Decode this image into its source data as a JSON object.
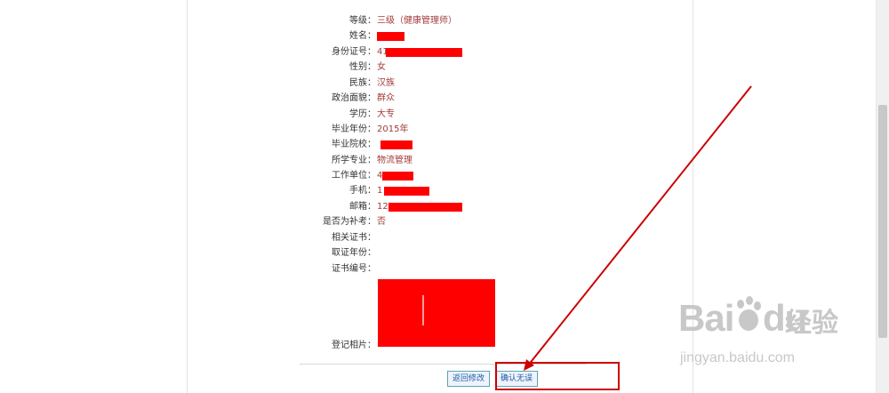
{
  "fields": [
    {
      "label": "等级：",
      "value": "三级（健康管理师）"
    },
    {
      "label": "姓名：",
      "value": ""
    },
    {
      "label": "身份证号：",
      "value": "41"
    },
    {
      "label": "性别：",
      "value": "女"
    },
    {
      "label": "民族：",
      "value": "汉族"
    },
    {
      "label": "政治面貌：",
      "value": "群众"
    },
    {
      "label": "学历：",
      "value": "大专"
    },
    {
      "label": "毕业年份：",
      "value": "2015年"
    },
    {
      "label": "毕业院校：",
      "value": ""
    },
    {
      "label": "所学专业：",
      "value": "物流管理"
    },
    {
      "label": "工作单位：",
      "value": "4"
    },
    {
      "label": "手机：",
      "value": "1"
    },
    {
      "label": "邮箱：",
      "value": "12"
    },
    {
      "label": "是否为补考：",
      "value": "否"
    },
    {
      "label": "相关证书：",
      "value": ""
    },
    {
      "label": "取证年份：",
      "value": ""
    },
    {
      "label": "证书编号：",
      "value": ""
    },
    {
      "label": "登记相片：",
      "value": ""
    }
  ],
  "actions": {
    "back_label": "返回修改",
    "confirm_label": "确认无误"
  },
  "watermark": {
    "logo_text": "Bai",
    "logo_text2": "du",
    "brand": "经验",
    "url": "jingyan.baidu.com"
  },
  "colors": {
    "value_text": "#a33b3b",
    "highlight": "#cc0000",
    "redaction": "#ff0000"
  }
}
